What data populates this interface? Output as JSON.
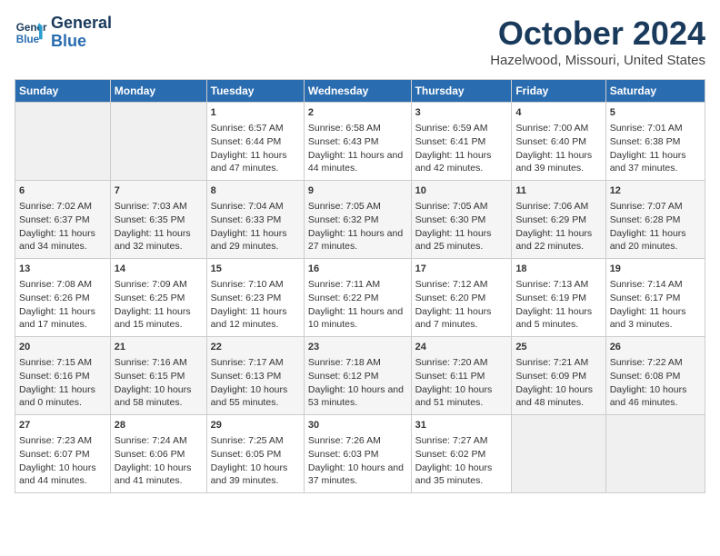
{
  "header": {
    "logo_line1": "General",
    "logo_line2": "Blue",
    "month": "October 2024",
    "location": "Hazelwood, Missouri, United States"
  },
  "weekdays": [
    "Sunday",
    "Monday",
    "Tuesday",
    "Wednesday",
    "Thursday",
    "Friday",
    "Saturday"
  ],
  "weeks": [
    [
      {
        "day": "",
        "empty": true
      },
      {
        "day": "",
        "empty": true
      },
      {
        "day": "1",
        "sunrise": "6:57 AM",
        "sunset": "6:44 PM",
        "daylight": "11 hours and 47 minutes."
      },
      {
        "day": "2",
        "sunrise": "6:58 AM",
        "sunset": "6:43 PM",
        "daylight": "11 hours and 44 minutes."
      },
      {
        "day": "3",
        "sunrise": "6:59 AM",
        "sunset": "6:41 PM",
        "daylight": "11 hours and 42 minutes."
      },
      {
        "day": "4",
        "sunrise": "7:00 AM",
        "sunset": "6:40 PM",
        "daylight": "11 hours and 39 minutes."
      },
      {
        "day": "5",
        "sunrise": "7:01 AM",
        "sunset": "6:38 PM",
        "daylight": "11 hours and 37 minutes."
      }
    ],
    [
      {
        "day": "6",
        "sunrise": "7:02 AM",
        "sunset": "6:37 PM",
        "daylight": "11 hours and 34 minutes."
      },
      {
        "day": "7",
        "sunrise": "7:03 AM",
        "sunset": "6:35 PM",
        "daylight": "11 hours and 32 minutes."
      },
      {
        "day": "8",
        "sunrise": "7:04 AM",
        "sunset": "6:33 PM",
        "daylight": "11 hours and 29 minutes."
      },
      {
        "day": "9",
        "sunrise": "7:05 AM",
        "sunset": "6:32 PM",
        "daylight": "11 hours and 27 minutes."
      },
      {
        "day": "10",
        "sunrise": "7:05 AM",
        "sunset": "6:30 PM",
        "daylight": "11 hours and 25 minutes."
      },
      {
        "day": "11",
        "sunrise": "7:06 AM",
        "sunset": "6:29 PM",
        "daylight": "11 hours and 22 minutes."
      },
      {
        "day": "12",
        "sunrise": "7:07 AM",
        "sunset": "6:28 PM",
        "daylight": "11 hours and 20 minutes."
      }
    ],
    [
      {
        "day": "13",
        "sunrise": "7:08 AM",
        "sunset": "6:26 PM",
        "daylight": "11 hours and 17 minutes."
      },
      {
        "day": "14",
        "sunrise": "7:09 AM",
        "sunset": "6:25 PM",
        "daylight": "11 hours and 15 minutes."
      },
      {
        "day": "15",
        "sunrise": "7:10 AM",
        "sunset": "6:23 PM",
        "daylight": "11 hours and 12 minutes."
      },
      {
        "day": "16",
        "sunrise": "7:11 AM",
        "sunset": "6:22 PM",
        "daylight": "11 hours and 10 minutes."
      },
      {
        "day": "17",
        "sunrise": "7:12 AM",
        "sunset": "6:20 PM",
        "daylight": "11 hours and 7 minutes."
      },
      {
        "day": "18",
        "sunrise": "7:13 AM",
        "sunset": "6:19 PM",
        "daylight": "11 hours and 5 minutes."
      },
      {
        "day": "19",
        "sunrise": "7:14 AM",
        "sunset": "6:17 PM",
        "daylight": "11 hours and 3 minutes."
      }
    ],
    [
      {
        "day": "20",
        "sunrise": "7:15 AM",
        "sunset": "6:16 PM",
        "daylight": "11 hours and 0 minutes."
      },
      {
        "day": "21",
        "sunrise": "7:16 AM",
        "sunset": "6:15 PM",
        "daylight": "10 hours and 58 minutes."
      },
      {
        "day": "22",
        "sunrise": "7:17 AM",
        "sunset": "6:13 PM",
        "daylight": "10 hours and 55 minutes."
      },
      {
        "day": "23",
        "sunrise": "7:18 AM",
        "sunset": "6:12 PM",
        "daylight": "10 hours and 53 minutes."
      },
      {
        "day": "24",
        "sunrise": "7:20 AM",
        "sunset": "6:11 PM",
        "daylight": "10 hours and 51 minutes."
      },
      {
        "day": "25",
        "sunrise": "7:21 AM",
        "sunset": "6:09 PM",
        "daylight": "10 hours and 48 minutes."
      },
      {
        "day": "26",
        "sunrise": "7:22 AM",
        "sunset": "6:08 PM",
        "daylight": "10 hours and 46 minutes."
      }
    ],
    [
      {
        "day": "27",
        "sunrise": "7:23 AM",
        "sunset": "6:07 PM",
        "daylight": "10 hours and 44 minutes."
      },
      {
        "day": "28",
        "sunrise": "7:24 AM",
        "sunset": "6:06 PM",
        "daylight": "10 hours and 41 minutes."
      },
      {
        "day": "29",
        "sunrise": "7:25 AM",
        "sunset": "6:05 PM",
        "daylight": "10 hours and 39 minutes."
      },
      {
        "day": "30",
        "sunrise": "7:26 AM",
        "sunset": "6:03 PM",
        "daylight": "10 hours and 37 minutes."
      },
      {
        "day": "31",
        "sunrise": "7:27 AM",
        "sunset": "6:02 PM",
        "daylight": "10 hours and 35 minutes."
      },
      {
        "day": "",
        "empty": true
      },
      {
        "day": "",
        "empty": true
      }
    ]
  ]
}
